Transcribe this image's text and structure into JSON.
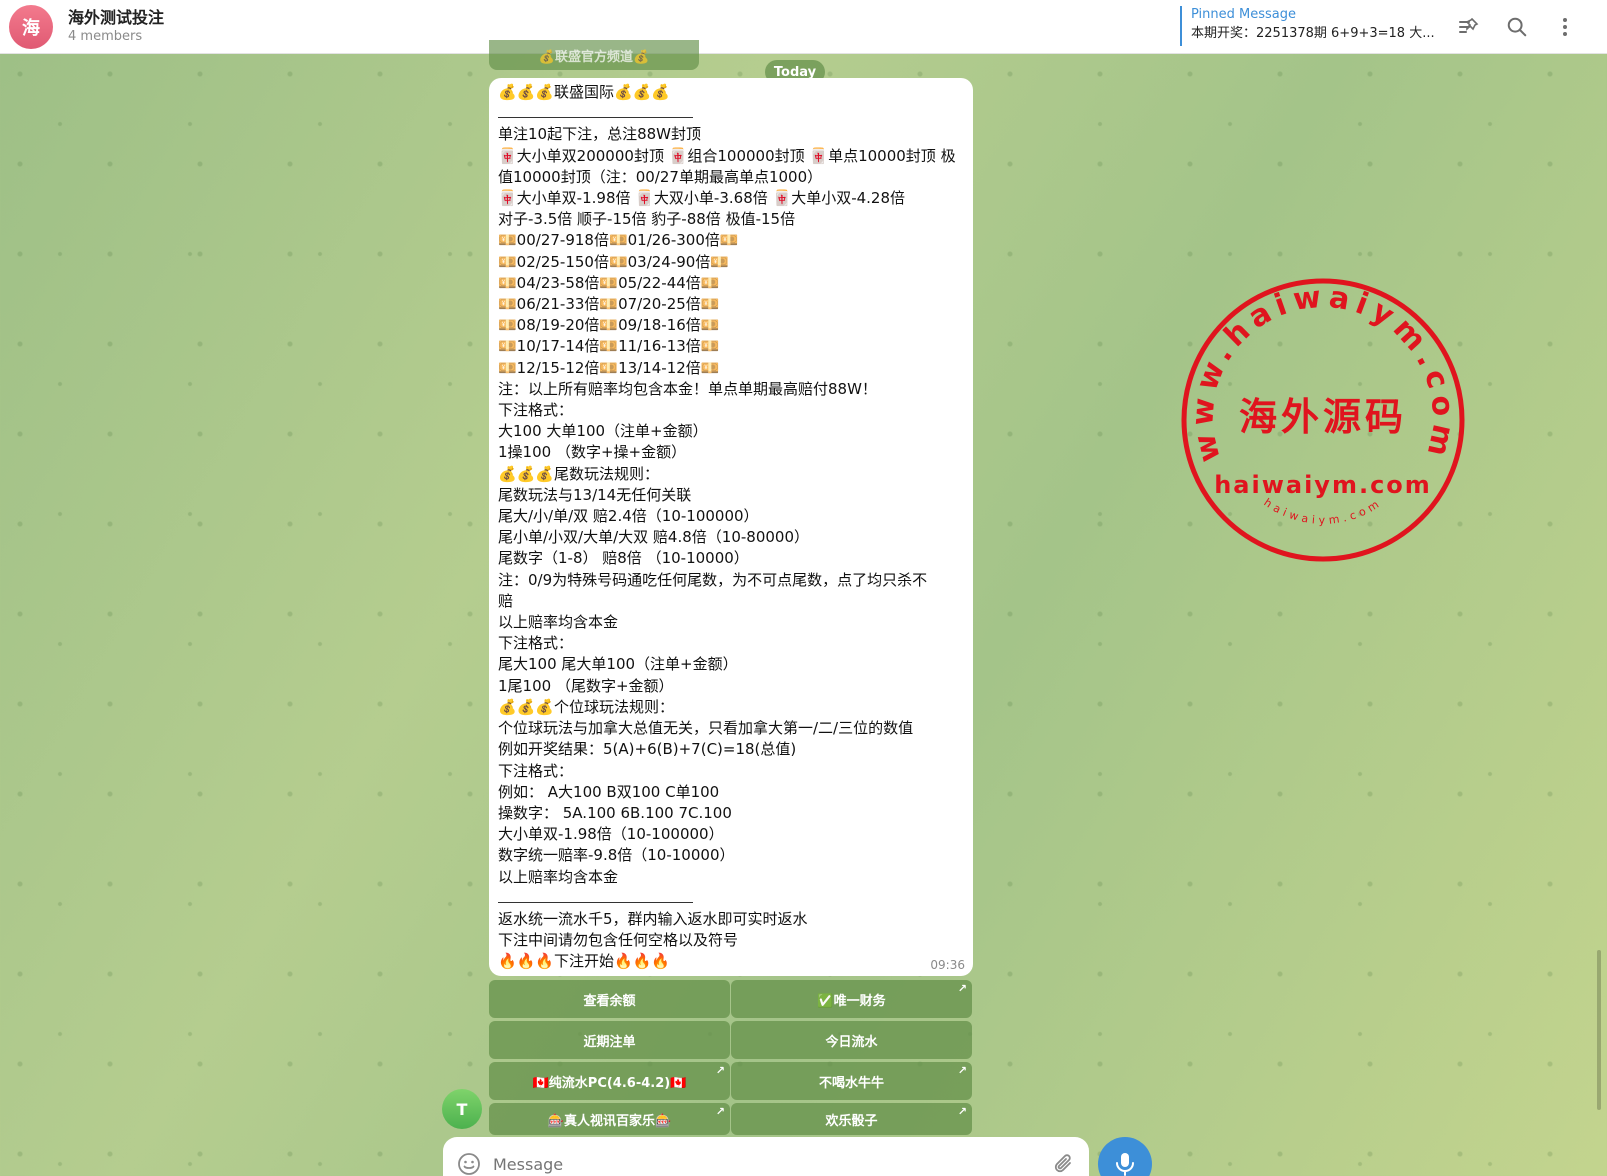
{
  "header": {
    "avatar_letter": "海",
    "title": "海外测试投注",
    "members": "4 members",
    "pinned_label": "Pinned Message",
    "pinned_text": "本期开奖：2251378期 6+9+3=18 大..."
  },
  "chat": {
    "prev_button_label": "💰联盛官方频道💰",
    "date_badge": "Today",
    "time": "09:36",
    "lines": [
      "💰💰💰联盛国际💰💰💰",
      "—",
      "单注10起下注，总注88W封顶",
      "🀄大小单双200000封顶 🀄组合100000封顶 🀄单点10000封顶 极",
      "值10000封顶（注：00/27单期最高单点1000）",
      "🀄大小单双-1.98倍 🀄大双小单-3.68倍 🀄大单小双-4.28倍",
      "对子-3.5倍 顺子-15倍 豹子-88倍 极值-15倍",
      "💴00/27-918倍💴01/26-300倍💴",
      "💴02/25-150倍💴03/24-90倍💴",
      "💴04/23-58倍💴05/22-44倍💴",
      "💴06/21-33倍💴07/20-25倍💴",
      "💴08/19-20倍💴09/18-16倍💴",
      "💴10/17-14倍💴11/16-13倍💴",
      "💴12/15-12倍💴13/14-12倍💴",
      "注：以上所有赔率均包含本金！单点单期最高赔付88W！",
      "下注格式：",
      "大100 大单100（注单+金额）",
      "1操100 （数字+操+金额）",
      "💰💰💰尾数玩法规则：",
      "尾数玩法与13/14无任何关联",
      "尾大/小/单/双  赔2.4倍（10-100000）",
      "尾小单/小双/大单/大双  赔4.8倍（10-80000）",
      "尾数字（1-8）  赔8倍 （10-10000）",
      "注：0/9为特殊号码通吃任何尾数，为不可点尾数，点了均只杀不",
      "赔",
      "以上赔率均含本金",
      "下注格式：",
      "尾大100 尾大单100（注单+金额）",
      "1尾100 （尾数字+金额）",
      "💰💰💰个位球玩法规则：",
      "个位球玩法与加拿大总值无关，只看加拿大第一/二/三位的数值",
      "例如开奖结果：5(A)+6(B)+7(C)=18(总值)",
      "下注格式：",
      "例如：   A大100  B双100  C单100",
      "操数字： 5A.100  6B.100   7C.100",
      "大小单双-1.98倍（10-100000）",
      "数字统一赔率-9.8倍（10-10000）",
      "以上赔率均含本金",
      "—",
      "返水统一流水千5，群内输入返水即可实时返水",
      "下注中间请勿包含任何空格以及符号",
      "🔥🔥🔥下注开始🔥🔥🔥"
    ]
  },
  "keyboard": {
    "rows": [
      [
        "查看余额",
        "✅唯一财务"
      ],
      [
        "近期注单",
        "今日流水"
      ],
      [
        "🇨🇦纯流水PC(4.6-4.2)🇨🇦",
        "不喝水牛牛"
      ],
      [
        "🎰真人视讯百家乐🎰",
        "欢乐骰子"
      ]
    ],
    "arrow": "↗"
  },
  "user_avatar_letter": "T",
  "composer": {
    "placeholder": "Message"
  },
  "stamp": {
    "outer_text": "www.haiwaiym.com",
    "center_text": "海外源码",
    "domain_text": "haiwaiym.com",
    "small_text": "haiwaiym.com",
    "color": "#e0141e"
  },
  "colors": {
    "accent": "#3d8fd8",
    "button_green": "#628f48"
  }
}
